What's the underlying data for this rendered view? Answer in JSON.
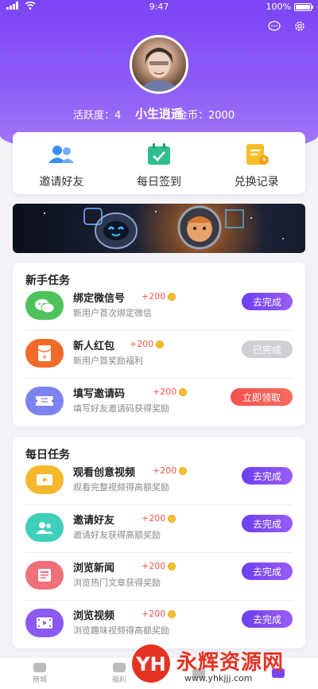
{
  "status": {
    "time": "9:47",
    "battery": "100%"
  },
  "profile": {
    "name": "小生逍遥",
    "activity": "活跃度：4",
    "coins": "金币：2000"
  },
  "quick": [
    {
      "label": "邀请好友",
      "icon": "people-icon"
    },
    {
      "label": "每日签到",
      "icon": "calendar-check-icon"
    },
    {
      "label": "兑换记录",
      "icon": "document-icon"
    }
  ],
  "newbie": {
    "title": "新手任务",
    "tasks": [
      {
        "title": "绑定微信号",
        "reward": "+200",
        "desc": "新用户首次绑定微信",
        "button": "去完成",
        "icon": "wechat-icon"
      },
      {
        "title": "新人红包",
        "reward": "+200",
        "desc": "新用户首奖励福利",
        "button": "已完成",
        "icon": "red-envelope-icon"
      },
      {
        "title": "填写邀请码",
        "reward": "+200",
        "desc": "填写好友邀请码获得奖励",
        "button": "立即领取",
        "icon": "ticket-icon"
      }
    ]
  },
  "daily": {
    "title": "每日任务",
    "tasks": [
      {
        "title": "观看创意视频",
        "reward": "+200",
        "desc": "观看完整视频得高额奖励",
        "button": "去完成",
        "icon": "video-icon"
      },
      {
        "title": "邀请好友",
        "reward": "+200",
        "desc": "邀请好友获得高额奖励",
        "button": "去完成",
        "icon": "people-icon"
      },
      {
        "title": "浏览新闻",
        "reward": "+200",
        "desc": "浏览热门文章获得奖励",
        "button": "去完成",
        "icon": "news-icon"
      },
      {
        "title": "浏览视频",
        "reward": "+200",
        "desc": "浏览趣味视频得高额奖励",
        "button": "去完成",
        "icon": "film-icon"
      }
    ]
  },
  "tabs": [
    "商城",
    "福利"
  ],
  "watermark": {
    "title": "永辉资源网",
    "url": "www.yhkjjj.com"
  },
  "colors": {
    "primary": "#7b45f4",
    "reward": "#f0574a",
    "green": "#4fc35a",
    "orange": "#f06a2a",
    "indigo": "#7c83f0",
    "yellow": "#f6b82c",
    "teal": "#3ed0b8",
    "pink": "#f0707a",
    "violet": "#8a5af3"
  }
}
